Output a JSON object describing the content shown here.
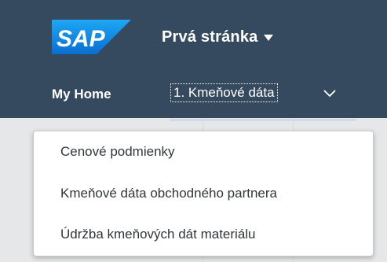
{
  "shell": {
    "logo_text": "SAP",
    "title": "Prvá stránka",
    "title_caret_icon": "caret-down-icon",
    "background_color": "#354a5f",
    "logo_color": "#1a8ce0"
  },
  "tabs": {
    "home_label": "My Home",
    "active_label": "1. Kmeňové dáta",
    "overflow_icon": "chevron-down-icon"
  },
  "dropdown": {
    "items": [
      {
        "label": "Cenové podmienky"
      },
      {
        "label": "Kmeňové dáta obchodného partnera"
      },
      {
        "label": "Údržba kmeňových dát materiálu"
      }
    ]
  }
}
